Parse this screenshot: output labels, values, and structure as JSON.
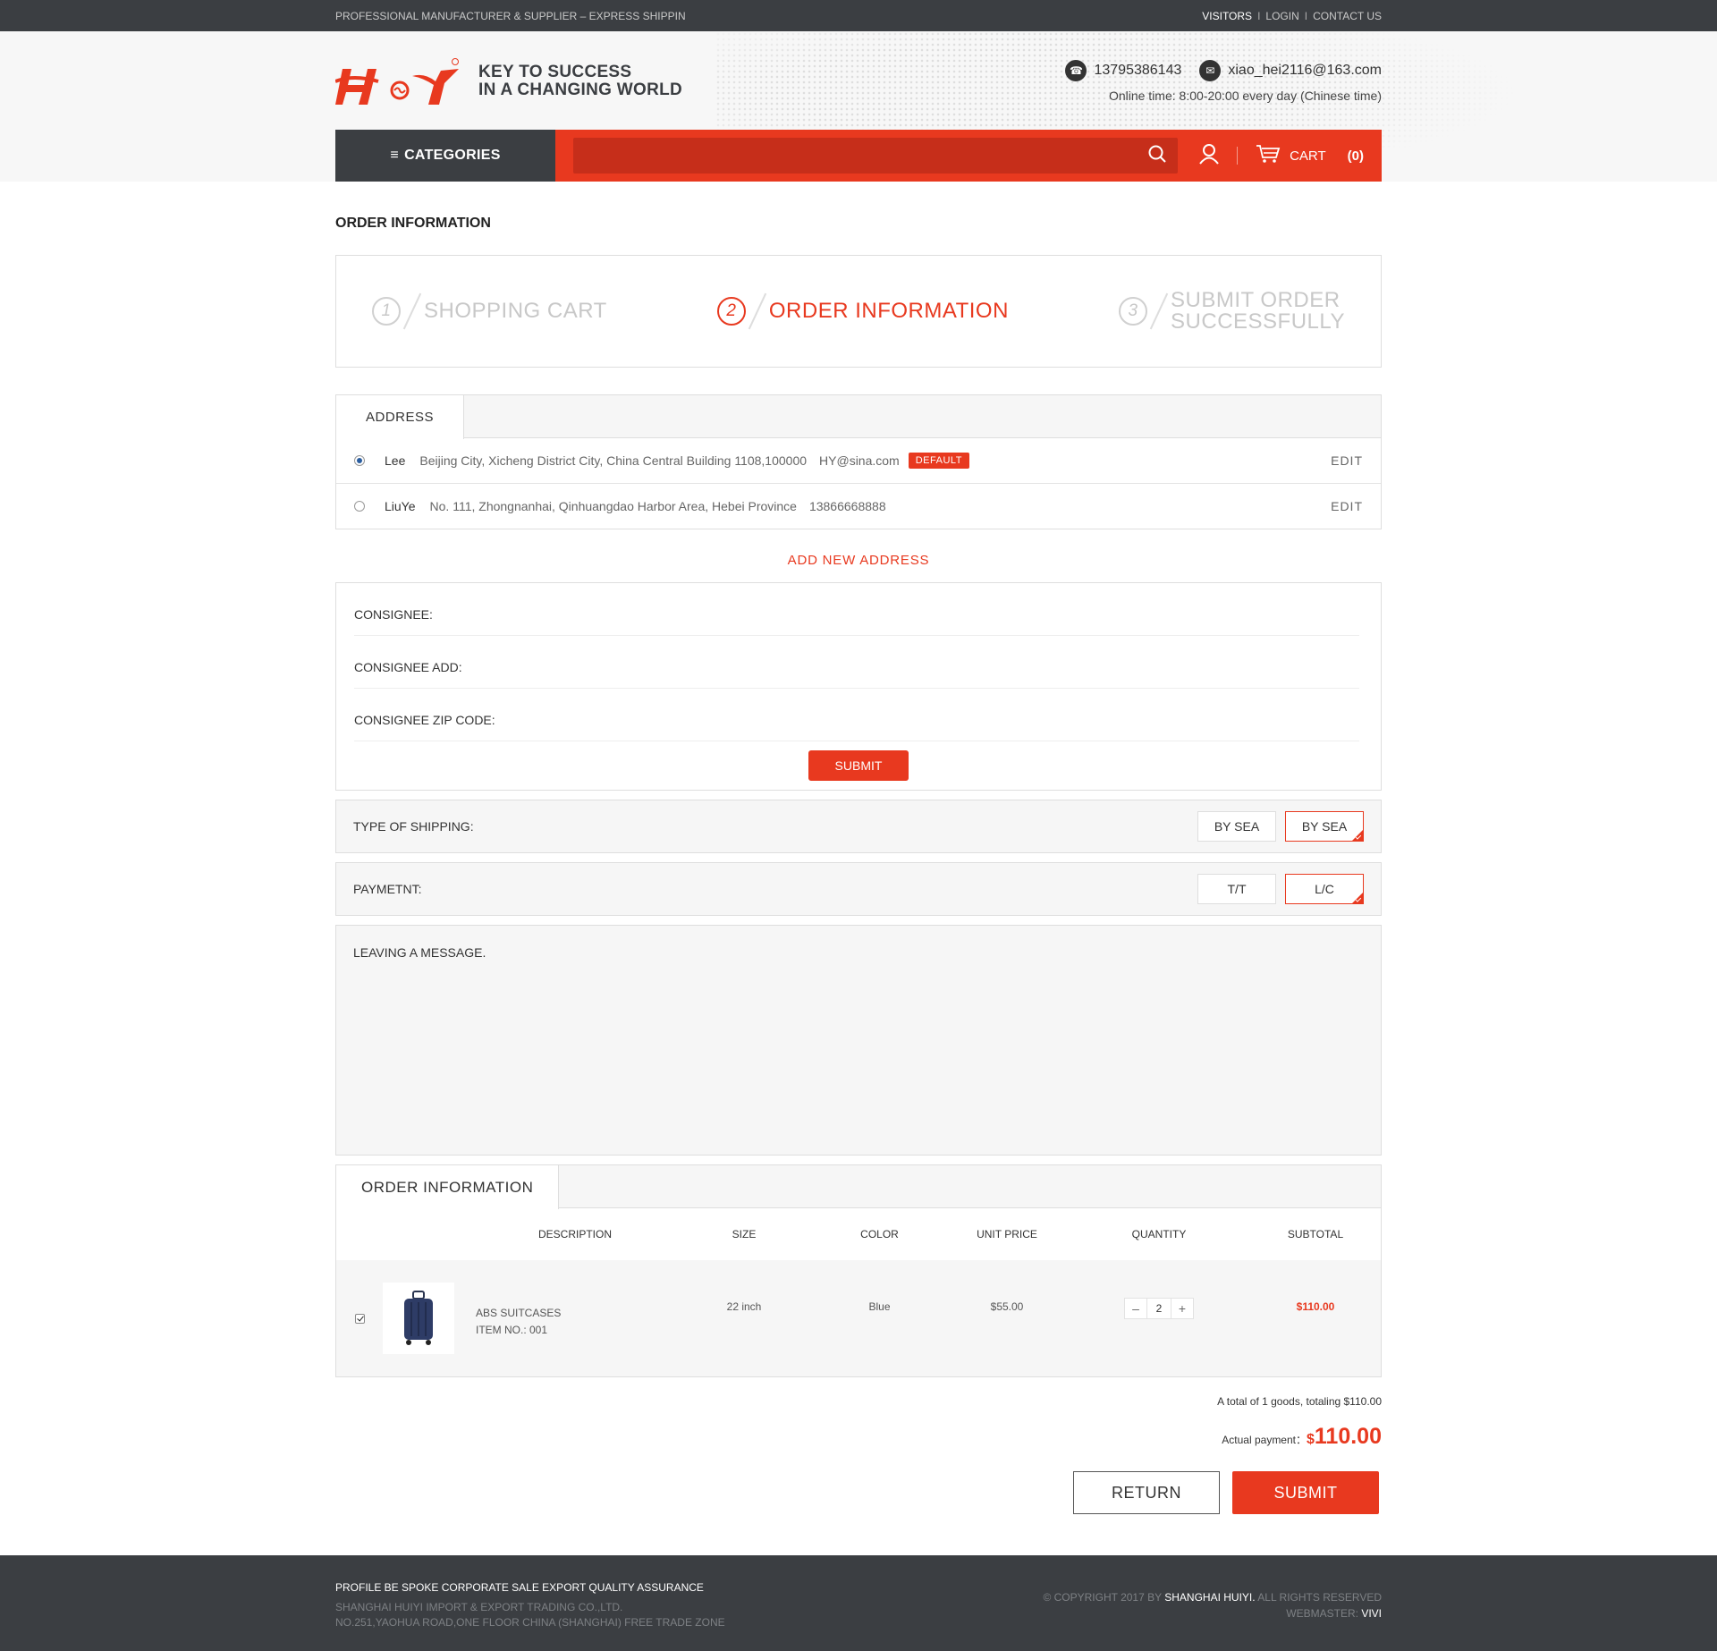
{
  "topbar": {
    "tagline": "PROFESSIONAL MANUFACTURER & SUPPLIER – EXPRESS SHIPPIN",
    "visitors": "VISITORS",
    "login": "LOGIN",
    "contact": "CONTACT US",
    "sep": "I"
  },
  "header": {
    "slogan_line1": "KEY TO SUCCESS",
    "slogan_line2": "IN A CHANGING WORLD",
    "phone": "13795386143",
    "email": "xiao_hei2116@163.com",
    "online": "Online time: 8:00-20:00 every day (Chinese time)"
  },
  "nav": {
    "categories": "CATEGORIES",
    "search_placeholder": "",
    "cart_label": "CART",
    "cart_count": "(0)"
  },
  "page": {
    "title": "ORDER INFORMATION"
  },
  "steps": [
    {
      "num": "1",
      "label": "SHOPPING CART",
      "active": false
    },
    {
      "num": "2",
      "label": "ORDER INFORMATION",
      "active": true
    },
    {
      "num": "3",
      "label_line1": "SUBMIT ORDER",
      "label_line2": "SUCCESSFULLY",
      "active": false
    }
  ],
  "address": {
    "tab": "ADDRESS",
    "rows": [
      {
        "name": "Lee",
        "addr": "Beijing City, Xicheng District City, China Central Building 1108,100000",
        "contact": "HY@sina.com",
        "badge": "DEFAULT",
        "edit": "EDIT",
        "selected": true
      },
      {
        "name": "LiuYe",
        "addr": "No. 111, Zhongnanhai, Qinhuangdao Harbor Area, Hebei Province",
        "contact": "13866668888",
        "edit": "EDIT",
        "selected": false
      }
    ],
    "add_new": "ADD NEW ADDRESS"
  },
  "form": {
    "consignee": "CONSIGNEE:",
    "consignee_add": "CONSIGNEE ADD:",
    "zip": "CONSIGNEE ZIP CODE:",
    "submit": "SUBMIT"
  },
  "shipping": {
    "label": "TYPE OF SHIPPING:",
    "options": [
      "BY SEA",
      "BY SEA"
    ],
    "selected_index": 1
  },
  "payment": {
    "label": "PAYMETNT:",
    "options": [
      "T/T",
      "L/C"
    ],
    "selected_index": 1
  },
  "message": {
    "placeholder": "LEAVING A MESSAGE."
  },
  "order": {
    "tab": "ORDER INFORMATION",
    "columns": {
      "description": "DESCRIPTION",
      "size": "SIZE",
      "color": "COLOR",
      "unit_price": "UNIT PRICE",
      "quantity": "QUANTITY",
      "subtotal": "SUBTOTAL"
    },
    "items": [
      {
        "name": "ABS SUITCASES",
        "item_no": "ITEM NO.: 001",
        "size": "22 inch",
        "color": "Blue",
        "unit_price": "$55.00",
        "quantity": "2",
        "subtotal": "$110.00",
        "checked": true
      }
    ],
    "summary": "A total of 1 goods, totaling $110.00",
    "actual_label": "Actual payment：",
    "currency": "$",
    "actual_amount": "110.00",
    "return": "RETURN",
    "submit": "SUBMIT"
  },
  "footer": {
    "links": "PROFILE BE SPOKE CORPORATE SALE EXPORT QUALITY ASSURANCE",
    "company": "SHANGHAI HUIYI IMPORT & EXPORT  TRADING CO.,LTD.",
    "address": "NO.251,YAOHUA ROAD,ONE FLOOR  CHINA (SHANGHAI) FREE TRADE ZONE",
    "copyright_pre": "© COPYRIGHT 2017 BY",
    "copyright_name": "SHANGHAI HUIYI.",
    "copyright_post": "ALL RIGHTS RESERVED",
    "webmaster_label": "WEBMASTER:",
    "webmaster": "VIVI"
  },
  "colors": {
    "accent": "#e8391f",
    "dark": "#3b3e42"
  }
}
